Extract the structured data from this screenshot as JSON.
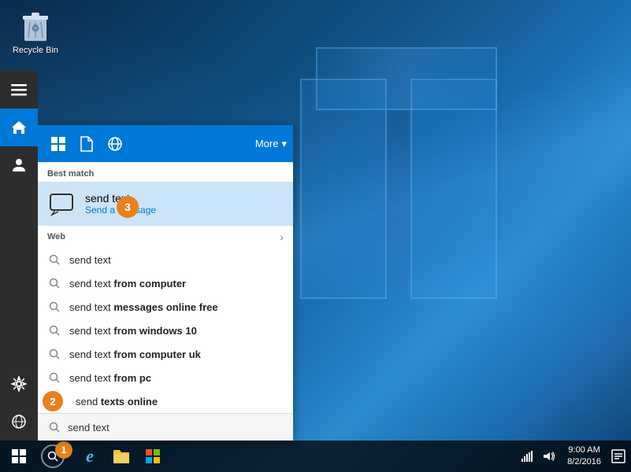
{
  "desktop": {
    "recycle_bin_label": "Recycle Bin"
  },
  "sidebar": {
    "items": [
      {
        "id": "hamburger",
        "label": "Menu",
        "active": false
      },
      {
        "id": "home",
        "label": "Home",
        "active": true
      },
      {
        "id": "user",
        "label": "User",
        "active": false
      },
      {
        "id": "settings",
        "label": "Settings",
        "active": false
      },
      {
        "id": "globe",
        "label": "Explore",
        "active": false
      }
    ]
  },
  "search_panel": {
    "top_bar": {
      "icons": [
        "apps",
        "document",
        "globe"
      ],
      "more_label": "More",
      "chevron": "▾"
    },
    "best_match": {
      "section_label": "Best match",
      "item_title": "send text",
      "item_subtitle": "Send a message",
      "badge_number": "3"
    },
    "web": {
      "section_label": "Web",
      "results": [
        {
          "text": "send text",
          "bold": ""
        },
        {
          "text": "send text ",
          "bold": "from computer"
        },
        {
          "text": "send text ",
          "bold": "messages online free"
        },
        {
          "text": "send text ",
          "bold": "from windows 10"
        },
        {
          "text": "send text ",
          "bold": "from computer uk"
        },
        {
          "text": "send text ",
          "bold": "from pc"
        },
        {
          "text": "send text",
          "bold_prefix": "d texts online",
          "number": "2"
        }
      ]
    },
    "search_input": {
      "value": "send text"
    }
  },
  "taskbar": {
    "start_label": "Start",
    "search_badge": "1",
    "edge_label": "e",
    "clock": {
      "time": "9:00 AM",
      "date": "8/2/2016"
    },
    "notification_label": "Action Center"
  }
}
